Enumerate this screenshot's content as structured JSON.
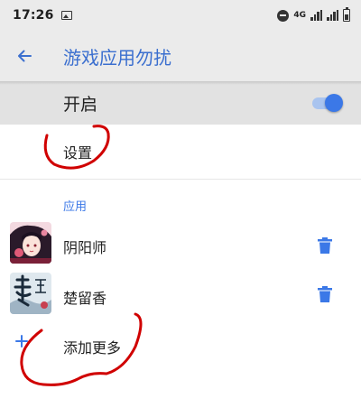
{
  "status_bar": {
    "time": "17:26",
    "network": "4G",
    "icons": [
      "gallery-icon",
      "do-not-disturb-icon",
      "signal-icon",
      "battery-icon"
    ]
  },
  "app_bar": {
    "back_icon": "arrow-back-icon",
    "title": "游戏应用勿扰"
  },
  "master_switch": {
    "label": "开启",
    "enabled": true
  },
  "settings": {
    "label": "设置"
  },
  "apps_section": {
    "header": "应用",
    "items": [
      {
        "name": "阴阳师",
        "icon": "onmyoji-app-icon",
        "action_icon": "delete-icon"
      },
      {
        "name": "楚留香",
        "icon": "chuliuxiang-app-icon",
        "action_icon": "delete-icon"
      }
    ]
  },
  "add_more": {
    "icon": "plus-icon",
    "label": "添加更多"
  },
  "colors": {
    "accent": "#3b78e7",
    "title": "#3b6fcf",
    "app_bar_bg": "#ebebeb",
    "master_row_bg": "#e2e2e2",
    "annotation": "#d00000"
  }
}
